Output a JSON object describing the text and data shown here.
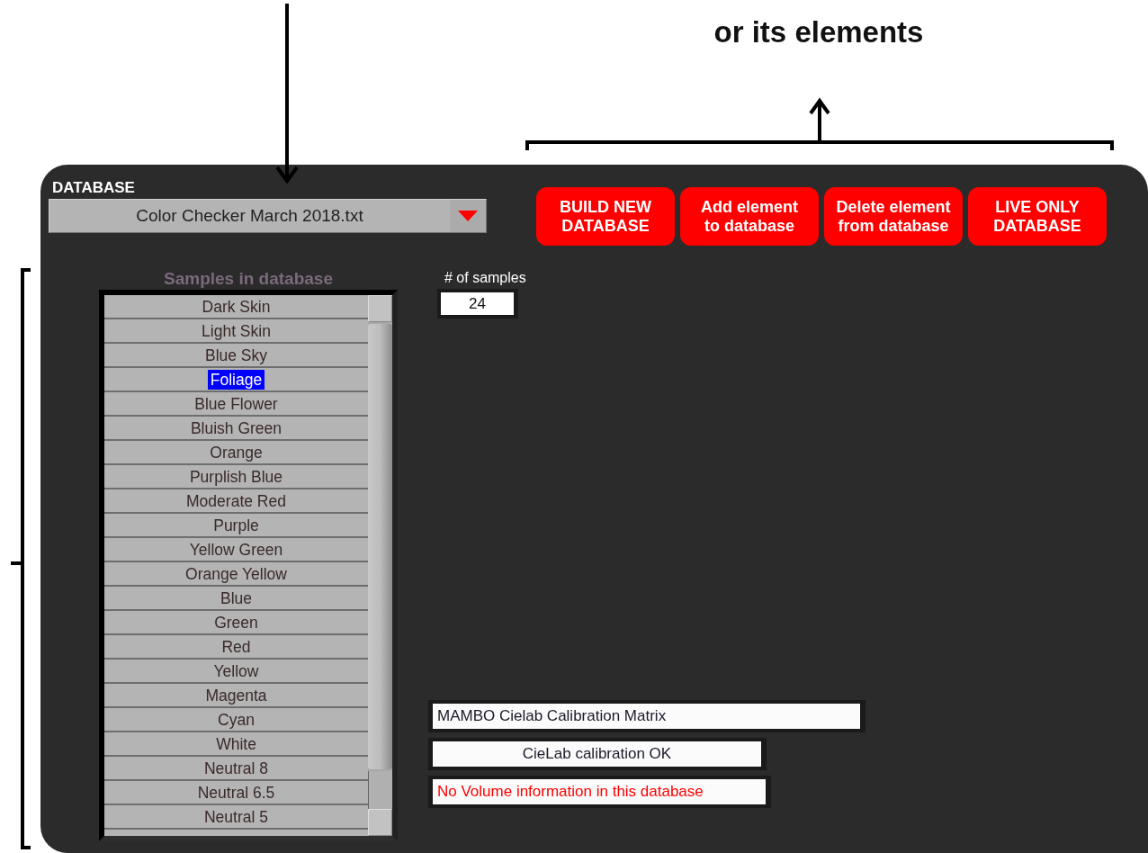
{
  "annotation": {
    "caption": "or its elements"
  },
  "database": {
    "label": "DATABASE",
    "file": "Color Checker March 2018.txt"
  },
  "buttons": [
    {
      "label": "BUILD NEW\nDATABASE"
    },
    {
      "label": "Add element\nto database"
    },
    {
      "label": "Delete element\nfrom database"
    },
    {
      "label": "LIVE ONLY\nDATABASE"
    }
  ],
  "samples": {
    "label": "Samples in database",
    "items": [
      {
        "name": "Dark Skin",
        "selected": false
      },
      {
        "name": "Light Skin",
        "selected": false
      },
      {
        "name": "Blue Sky",
        "selected": false
      },
      {
        "name": "Foliage",
        "selected": true
      },
      {
        "name": "Blue Flower",
        "selected": false
      },
      {
        "name": "Bluish Green",
        "selected": false
      },
      {
        "name": "Orange",
        "selected": false
      },
      {
        "name": "Purplish Blue",
        "selected": false
      },
      {
        "name": "Moderate Red",
        "selected": false
      },
      {
        "name": "Purple",
        "selected": false
      },
      {
        "name": "Yellow Green",
        "selected": false
      },
      {
        "name": "Orange Yellow",
        "selected": false
      },
      {
        "name": "Blue",
        "selected": false
      },
      {
        "name": "Green",
        "selected": false
      },
      {
        "name": "Red",
        "selected": false
      },
      {
        "name": "Yellow",
        "selected": false
      },
      {
        "name": "Magenta",
        "selected": false
      },
      {
        "name": "Cyan",
        "selected": false
      },
      {
        "name": "White",
        "selected": false
      },
      {
        "name": "Neutral 8",
        "selected": false
      },
      {
        "name": "Neutral 6.5",
        "selected": false
      },
      {
        "name": "Neutral 5",
        "selected": false
      }
    ]
  },
  "count": {
    "label": "# of samples",
    "value": "24"
  },
  "status_fields": [
    {
      "text": "MAMBO Cielab Calibration Matrix",
      "kind": "info"
    },
    {
      "text": "CieLab calibration OK",
      "kind": "ok"
    },
    {
      "text": "No Volume information in this database",
      "kind": "warning"
    }
  ]
}
